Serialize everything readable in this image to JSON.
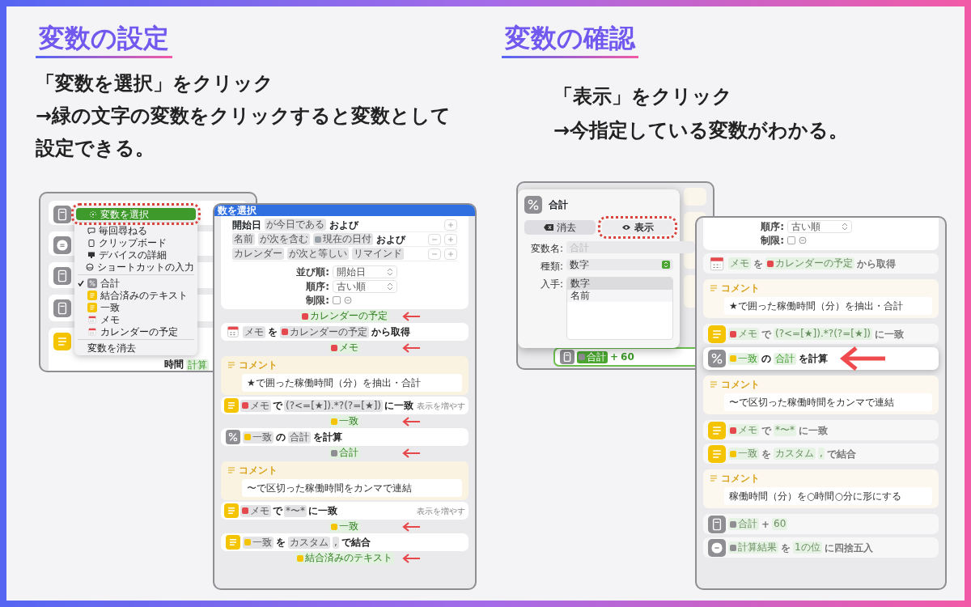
{
  "setting": {
    "heading": "変数の設定",
    "instructions": [
      "「変数を選択」をクリック",
      "→緑の文字の変数をクリックすると変数として",
      "設定できる。"
    ],
    "menu_screenshot": {
      "rows": [
        {
          "kind": "calculator"
        },
        {
          "kind": "equals"
        },
        {
          "kind": "calculator"
        },
        {
          "kind": "calculator"
        },
        {
          "kind": "text",
          "trailing_text": "時間",
          "trailing_chip": "計算"
        }
      ],
      "menu": [
        [
          {
            "label": "変数を選択",
            "kind": "select",
            "selected": true,
            "checked": false
          }
        ],
        [
          {
            "label": "毎回尋ねる",
            "kind": "ask",
            "selected": false,
            "checked": false
          },
          {
            "label": "クリップボード",
            "kind": "clipboard",
            "selected": false,
            "checked": false
          },
          {
            "label": "デバイスの詳細",
            "kind": "device",
            "selected": false,
            "checked": false
          },
          {
            "label": "ショートカットの入力",
            "kind": "input",
            "selected": false,
            "checked": false
          }
        ],
        [
          {
            "label": "合計",
            "kind": "percent",
            "selected": false,
            "checked": true
          },
          {
            "label": "結合済みのテキスト",
            "kind": "text",
            "selected": false,
            "checked": false
          },
          {
            "label": "一致",
            "kind": "text",
            "selected": false,
            "checked": false
          },
          {
            "label": "メモ",
            "kind": "calendar",
            "selected": false,
            "checked": false
          },
          {
            "label": "カレンダーの予定",
            "kind": "calendar",
            "selected": false,
            "checked": false
          }
        ],
        [
          {
            "label": "変数を消去",
            "kind": "plain",
            "selected": false,
            "checked": false
          }
        ]
      ]
    },
    "picker_screenshot": {
      "title": "数を選択",
      "filters": [
        {
          "removable": false,
          "parts": [
            {
              "text": "開始日",
              "kind": "word"
            },
            {
              "text": "が今日である",
              "kind": "chip"
            },
            {
              "text": "および",
              "kind": "word"
            }
          ]
        },
        {
          "removable": true,
          "parts": [
            {
              "text": "名前",
              "kind": "chip"
            },
            {
              "text": "が次を含む",
              "kind": "chip"
            },
            {
              "text": "現在の日付",
              "kind": "var",
              "color": "#9aa0a6"
            },
            {
              "text": "および",
              "kind": "word"
            }
          ]
        },
        {
          "removable": true,
          "parts": [
            {
              "text": "カレンダー",
              "kind": "chip"
            },
            {
              "text": "が次と等しい",
              "kind": "chip"
            },
            {
              "text": "リマインド",
              "kind": "chip"
            }
          ]
        }
      ],
      "sort": [
        {
          "label": "並び順:",
          "value": "開始日"
        },
        {
          "label": "順序:",
          "value": "古い順"
        }
      ],
      "limit": {
        "label": "制限:",
        "checked": false
      },
      "flow": [
        {
          "kind": "output",
          "arrow": true,
          "parts": [
            {
              "text": "カレンダーの予定",
              "kind": "var",
              "color": "#e5484d"
            }
          ]
        },
        {
          "kind": "calendar",
          "parts": [
            {
              "text": "メモ",
              "kind": "chip"
            },
            {
              "text": "を",
              "kind": "word"
            },
            {
              "text": "カレンダーの予定",
              "kind": "var",
              "color": "#e5484d"
            },
            {
              "text": "から取得",
              "kind": "word"
            }
          ]
        },
        {
          "kind": "output",
          "arrow": true,
          "parts": [
            {
              "text": "メモ",
              "kind": "var",
              "color": "#e5484d"
            }
          ]
        },
        {
          "kind": "comment",
          "title": "コメント",
          "text": "★で囲った稼働時間（分）を抽出・合計"
        },
        {
          "kind": "text",
          "more": "表示を増やす",
          "parts": [
            {
              "text": "メモ",
              "kind": "var",
              "color": "#e5484d"
            },
            {
              "text": "で",
              "kind": "word"
            },
            {
              "text": "(?<=[★]).*?(?=[★])",
              "kind": "chip"
            },
            {
              "text": "に一致",
              "kind": "word"
            }
          ]
        },
        {
          "kind": "output",
          "arrow": true,
          "parts": [
            {
              "text": "一致",
              "kind": "var",
              "color": "#f5c400"
            }
          ]
        },
        {
          "kind": "percent",
          "parts": [
            {
              "text": "一致",
              "kind": "var",
              "color": "#f5c400"
            },
            {
              "text": "の",
              "kind": "word"
            },
            {
              "text": "合計",
              "kind": "chip"
            },
            {
              "text": "を計算",
              "kind": "word"
            }
          ]
        },
        {
          "kind": "output",
          "arrow": true,
          "parts": [
            {
              "text": "合計",
              "kind": "var",
              "color": "#8e8e93"
            }
          ]
        },
        {
          "kind": "comment",
          "title": "コメント",
          "text": "〜で区切った稼働時間をカンマで連結"
        },
        {
          "kind": "text",
          "more": "表示を増やす",
          "parts": [
            {
              "text": "メモ",
              "kind": "var",
              "color": "#e5484d"
            },
            {
              "text": "で",
              "kind": "word"
            },
            {
              "text": "*〜*",
              "kind": "chip"
            },
            {
              "text": "に一致",
              "kind": "word"
            }
          ]
        },
        {
          "kind": "output",
          "arrow": true,
          "parts": [
            {
              "text": "一致",
              "kind": "var",
              "color": "#f5c400"
            }
          ]
        },
        {
          "kind": "text",
          "parts": [
            {
              "text": "一致",
              "kind": "var",
              "color": "#f5c400"
            },
            {
              "text": "を",
              "kind": "word"
            },
            {
              "text": "カスタム",
              "kind": "chip"
            },
            {
              "text": ",",
              "kind": "chip"
            },
            {
              "text": "で結合",
              "kind": "word"
            }
          ]
        },
        {
          "kind": "output",
          "arrow": true,
          "parts": [
            {
              "text": "結合済みのテキスト",
              "kind": "var",
              "color": "#f5c400"
            }
          ]
        }
      ]
    }
  },
  "checking": {
    "heading": "変数の確認",
    "instructions": [
      "「表示」をクリック",
      "→今指定している変数がわかる。"
    ],
    "popover_screenshot": {
      "title": "合計",
      "buttons": [
        {
          "label": "消去",
          "kind": "clear",
          "selected": false
        },
        {
          "label": "表示",
          "kind": "show",
          "selected": true
        }
      ],
      "name_field": {
        "label": "変数名:",
        "placeholder": "合計"
      },
      "type_field": {
        "label": "種類:",
        "value": "数字"
      },
      "source_field": {
        "label": "入手:",
        "options": [
          {
            "label": "数字",
            "selected": true
          },
          {
            "label": "名前",
            "selected": false
          }
        ]
      },
      "action": {
        "kind": "calculator",
        "focused": true,
        "parts": [
          {
            "text": "合計",
            "kind": "var",
            "color": "#8e8e93"
          },
          {
            "text": "+",
            "kind": "word"
          },
          {
            "text": "60",
            "kind": "word"
          }
        ]
      }
    },
    "editor_screenshot": {
      "sort": {
        "label": "順序:",
        "value": "古い順"
      },
      "limit": {
        "label": "制限:",
        "checked": false
      },
      "flow": [
        {
          "kind": "calendar",
          "focused": false,
          "parts": [
            {
              "text": "メモ",
              "kind": "chip"
            },
            {
              "text": "を",
              "kind": "word"
            },
            {
              "text": "カレンダーの予定",
              "kind": "var",
              "color": "#e5484d"
            },
            {
              "text": "から取得",
              "kind": "word"
            }
          ]
        },
        {
          "kind": "comment",
          "focused": false,
          "title": "コメント",
          "text": "★で囲った稼働時間（分）を抽出・合計"
        },
        {
          "kind": "text",
          "focused": false,
          "parts": [
            {
              "text": "メモ",
              "kind": "var",
              "color": "#e5484d"
            },
            {
              "text": "で",
              "kind": "word"
            },
            {
              "text": "(?<=[★]).*?(?=[★])",
              "kind": "chip"
            },
            {
              "text": "に一致",
              "kind": "word"
            }
          ]
        },
        {
          "kind": "percent",
          "focused": true,
          "parts": [
            {
              "text": "一致",
              "kind": "var",
              "color": "#f5c400"
            },
            {
              "text": "の",
              "kind": "word"
            },
            {
              "text": "合計",
              "kind": "chip"
            },
            {
              "text": "を計算",
              "kind": "word"
            }
          ]
        },
        {
          "kind": "comment",
          "focused": false,
          "title": "コメント",
          "text": "〜で区切った稼働時間をカンマで連結"
        },
        {
          "kind": "text",
          "focused": false,
          "parts": [
            {
              "text": "メモ",
              "kind": "var",
              "color": "#e5484d"
            },
            {
              "text": "で",
              "kind": "word"
            },
            {
              "text": "*〜*",
              "kind": "chip"
            },
            {
              "text": "に一致",
              "kind": "word"
            }
          ]
        },
        {
          "kind": "text",
          "focused": false,
          "parts": [
            {
              "text": "一致",
              "kind": "var",
              "color": "#f5c400"
            },
            {
              "text": "を",
              "kind": "word"
            },
            {
              "text": "カスタム",
              "kind": "chip"
            },
            {
              "text": ",",
              "kind": "chip"
            },
            {
              "text": "で結合",
              "kind": "word"
            }
          ]
        },
        {
          "kind": "comment",
          "focused": false,
          "title": "コメント",
          "text": "稼働時間（分）を○時間○分に形にする"
        },
        {
          "kind": "calculator",
          "focused": false,
          "parts": [
            {
              "text": "合計",
              "kind": "var",
              "color": "#8e8e93"
            },
            {
              "text": "+",
              "kind": "word"
            },
            {
              "text": "60",
              "kind": "chip"
            }
          ]
        },
        {
          "kind": "round",
          "focused": false,
          "parts": [
            {
              "text": "計算結果",
              "kind": "var",
              "color": "#8e8e93"
            },
            {
              "text": "を",
              "kind": "word"
            },
            {
              "text": "1の位",
              "kind": "chip"
            },
            {
              "text": "に四捨五入",
              "kind": "word"
            }
          ]
        }
      ]
    }
  }
}
